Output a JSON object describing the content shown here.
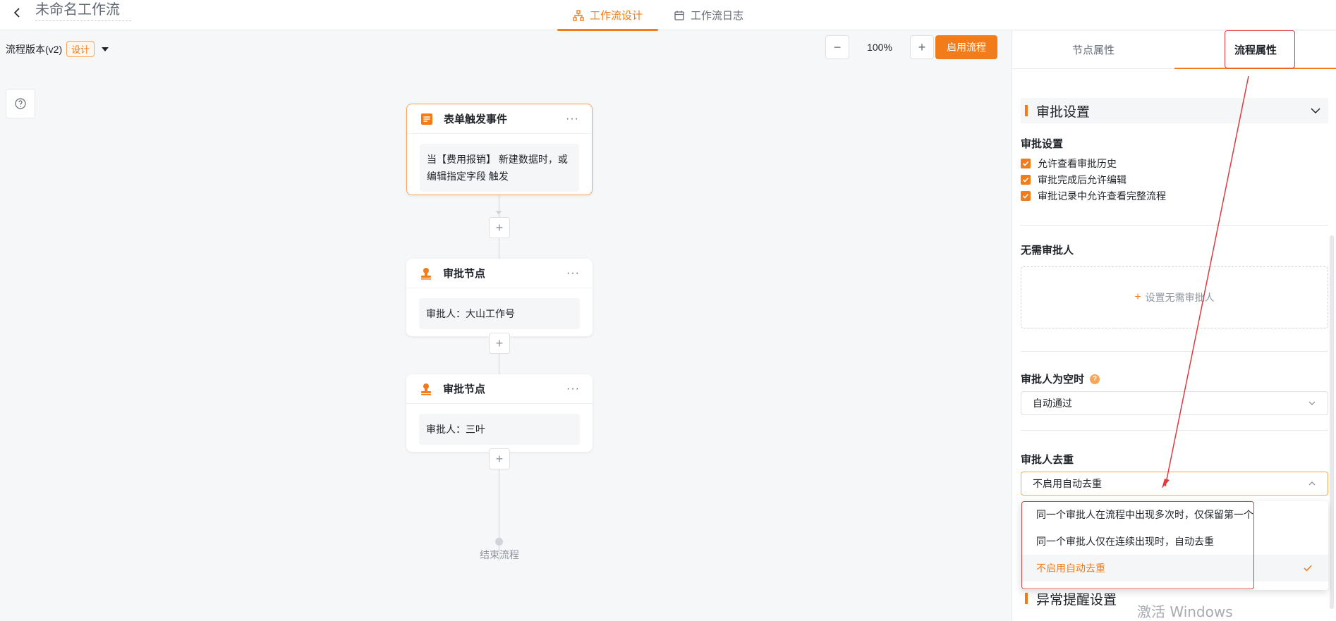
{
  "header": {
    "title": "未命名工作流",
    "tabs": [
      {
        "label": "工作流设计",
        "icon": "flow-icon",
        "active": true
      },
      {
        "label": "工作流日志",
        "icon": "calendar-icon",
        "active": false
      }
    ]
  },
  "canvas": {
    "version_label": "流程版本(v2)",
    "version_badge": "设计",
    "zoom_minus": "−",
    "zoom_value": "100%",
    "zoom_plus": "+",
    "start_button": "启用流程",
    "nodes": [
      {
        "type": "trigger",
        "title": "表单触发事件",
        "more": "···",
        "body": "当【费用报销】 新建数据时，或编辑指定字段 触发"
      },
      {
        "type": "approval",
        "title": "审批节点",
        "more": "···",
        "body": "审批人：大山工作号"
      },
      {
        "type": "approval",
        "title": "审批节点",
        "more": "···",
        "body": "审批人：三叶"
      }
    ],
    "add_symbol": "+",
    "end_label": "结束流程"
  },
  "panel": {
    "tabs": [
      {
        "label": "节点属性",
        "active": false
      },
      {
        "label": "流程属性",
        "active": true
      }
    ],
    "section_title": "审批设置",
    "approval_settings_label": "审批设置",
    "checkboxes": [
      {
        "label": "允许查看审批历史",
        "checked": true
      },
      {
        "label": "审批完成后允许编辑",
        "checked": true
      },
      {
        "label": "审批记录中允许查看完整流程",
        "checked": true
      }
    ],
    "no_approver_label": "无需审批人",
    "no_approver_add": "设置无需审批人",
    "empty_approver_label": "审批人为空时",
    "empty_approver_help": "?",
    "empty_approver_value": "自动通过",
    "dedup_label": "审批人去重",
    "dedup_value": "不启用自动去重",
    "dedup_options": [
      {
        "label": "同一个审批人在流程中出现多次时，仅保留第一个",
        "selected": false
      },
      {
        "label": "同一个审批人仅在连续出现时，自动去重",
        "selected": false
      },
      {
        "label": "不启用自动去重",
        "selected": true
      }
    ],
    "next_section_title": "异常提醒设置"
  },
  "watermark": "激活 Windows",
  "colors": {
    "accent": "#f27c19",
    "annotation": "#e0393e"
  }
}
